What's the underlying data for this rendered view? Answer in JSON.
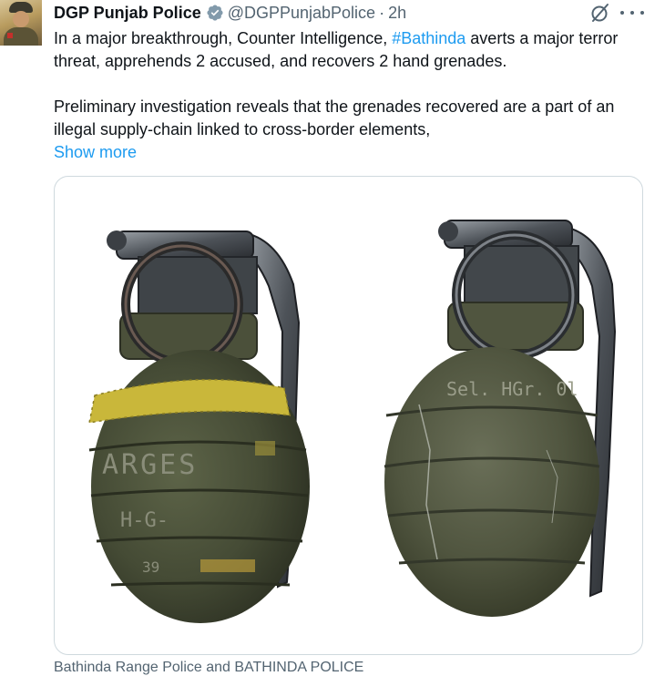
{
  "author": {
    "name": "DGP Punjab Police",
    "handle": "@DGPPunjabPolice",
    "separator": "·",
    "time": "2h"
  },
  "tweet": {
    "line1_prefix": "In a major breakthrough, Counter Intelligence, ",
    "hashtag": "#Bathinda",
    "line1_suffix": " averts a major terror threat, apprehends 2 accused, and recovers 2 hand grenades.",
    "paragraph2": "Preliminary investigation reveals that the grenades recovered are a part of an illegal supply-chain linked to cross-border elements,",
    "show_more": "Show more"
  },
  "media": {
    "grenade_left_markings": [
      "ARGES",
      "H-G-",
      "39"
    ],
    "grenade_right_markings": [
      "Sel. HGr. 0l"
    ]
  },
  "caption": "Bathinda Range Police and BATHINDA POLICE",
  "icons": {
    "verified": "verified-badge-icon",
    "grok": "grok-icon",
    "more": "more-options-icon"
  },
  "colors": {
    "link": "#1d9bf0",
    "secondary_text": "#536471",
    "verified_badge": "#829aab"
  }
}
